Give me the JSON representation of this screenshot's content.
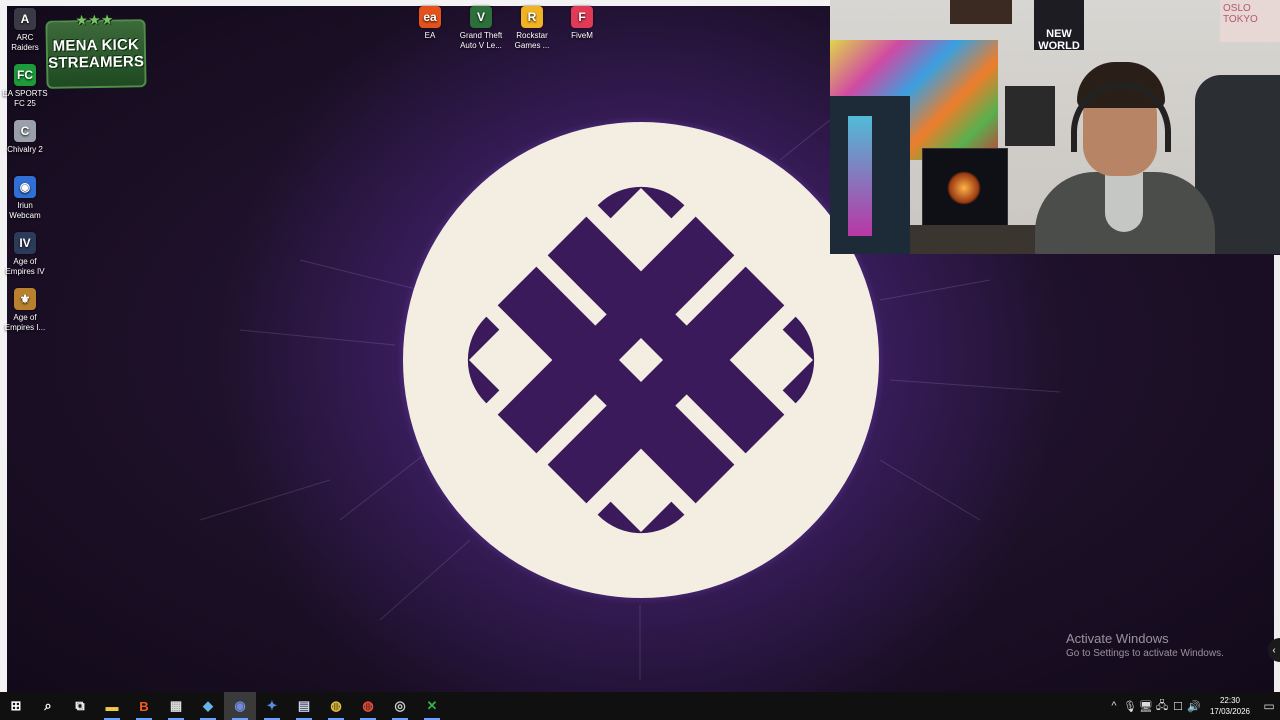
{
  "desktop": {
    "top_icons": [
      {
        "label": "EA",
        "color": "#e4521b",
        "glyph": "ea"
      },
      {
        "label": "Grand Theft\nAuto V Le...",
        "color": "#2c6f3b",
        "glyph": "V"
      },
      {
        "label": "Rockstar\nGames ...",
        "color": "#f0b323",
        "glyph": "R"
      },
      {
        "label": "FiveM",
        "color": "#e03a56",
        "glyph": "F"
      }
    ],
    "left_icons": [
      {
        "label": "ARC Raiders",
        "color": "#3a3a44",
        "glyph": "A"
      },
      {
        "label": "EA SPORTS\nFC 25",
        "color": "#1d9b3a",
        "glyph": "FC"
      },
      {
        "label": "Chivalry 2",
        "color": "#9aa0aa",
        "glyph": "C"
      },
      {
        "label": "Iriun\nWebcam",
        "color": "#2f6fd6",
        "glyph": "◉"
      },
      {
        "label": "Age of\nEmpires IV",
        "color": "#2d3b5a",
        "glyph": "IV"
      },
      {
        "label": "Age of\nEmpires I...",
        "color": "#b9812e",
        "glyph": "⚜"
      }
    ],
    "badge": {
      "line1": "MENA KICK",
      "line2": "STREAMERS",
      "stars": "★★★"
    },
    "wallpaper_colors": {
      "background": "#1d1028",
      "logo_circle": "#f4ede2",
      "logo_purple": "#3b1a5c"
    }
  },
  "webcam": {
    "poster_text": "NEW\nWORLD",
    "poster2_text": "OSLO TOKYO"
  },
  "watermark": {
    "title": "Activate Windows",
    "subtitle": "Go to Settings to activate Windows."
  },
  "taskbar": {
    "apps": [
      {
        "name": "windows-start",
        "glyph": "⊞",
        "color": "#ffffff"
      },
      {
        "name": "search",
        "glyph": "⌕",
        "color": "#ffffff"
      },
      {
        "name": "task-view",
        "glyph": "⧉",
        "color": "#ffffff"
      },
      {
        "name": "file-explorer",
        "glyph": "▬",
        "color": "#f2c84b"
      },
      {
        "name": "brave",
        "glyph": "B",
        "color": "#f25b24"
      },
      {
        "name": "store",
        "glyph": "▦",
        "color": "#dddddd"
      },
      {
        "name": "notes",
        "glyph": "◆",
        "color": "#66b3e8"
      },
      {
        "name": "discord",
        "glyph": "◉",
        "color": "#7289da"
      },
      {
        "name": "tool",
        "glyph": "✦",
        "color": "#5a8fd8"
      },
      {
        "name": "document",
        "glyph": "▤",
        "color": "#c8d2e8"
      },
      {
        "name": "chrome",
        "glyph": "◍",
        "color": "#e8c23a"
      },
      {
        "name": "chrome-2",
        "glyph": "◍",
        "color": "#e84e3a"
      },
      {
        "name": "obs",
        "glyph": "◎",
        "color": "#cccccc"
      },
      {
        "name": "xbox",
        "glyph": "✕",
        "color": "#2fb54a"
      }
    ],
    "tray": {
      "icons": [
        "^",
        "🎙",
        "🖥",
        "🖧",
        "☐",
        "🔊"
      ],
      "time": "22:30",
      "date": "17/03/2026"
    }
  }
}
